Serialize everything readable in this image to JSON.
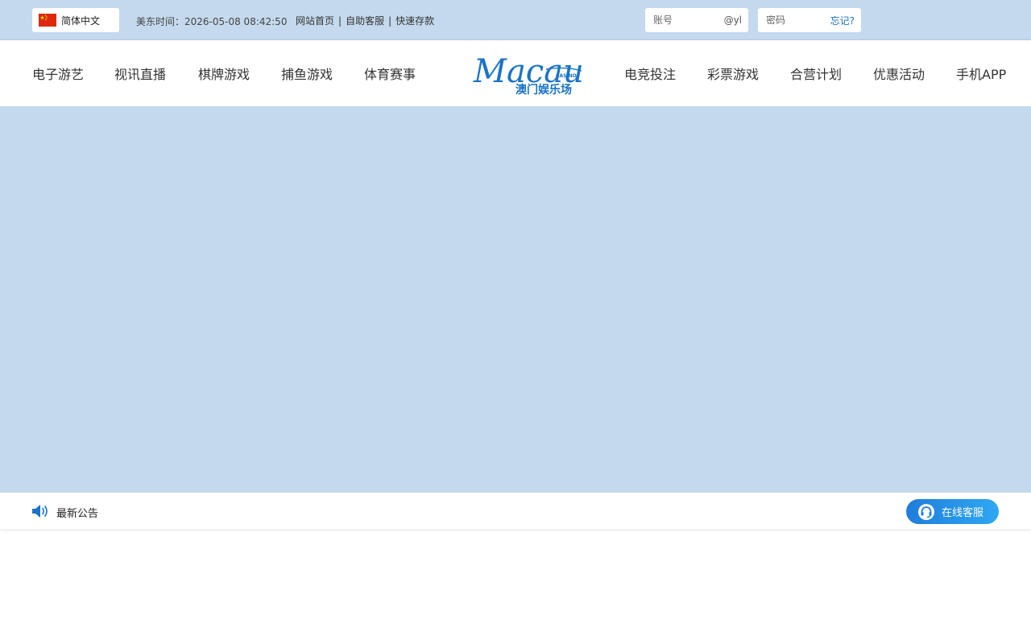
{
  "topbar": {
    "language": {
      "icon": "china-flag-icon",
      "label": "简体中文"
    },
    "clock_text": "美东时间：2026-05-08 08:42:50",
    "links": [
      "网站首页",
      "自助客服",
      "快速存款"
    ],
    "link_separator": "|",
    "account_field": {
      "placeholder": "账号",
      "suffix": "@yl"
    },
    "password_field": {
      "placeholder": "密码",
      "forgot_label": "忘记?"
    }
  },
  "nav": {
    "left_items": [
      "电子游艺",
      "视讯直播",
      "棋牌游戏",
      "捕鱼游戏",
      "体育赛事"
    ],
    "right_items": [
      "电竞投注",
      "彩票游戏",
      "合营计划",
      "优惠活动",
      "手机APP"
    ],
    "logo": {
      "script_text": "Macau",
      "tag_text": "CASINO",
      "name_text": "澳门娱乐场"
    }
  },
  "notice": {
    "icon": "speaker-icon",
    "label": "最新公告"
  },
  "customer_service": {
    "icon": "headset-icon",
    "label": "在线客服"
  },
  "colors": {
    "topbar_bg": "#c4d9ed",
    "banner_bg": "#c4d9ed",
    "brand_blue": "#1a73c8",
    "cs_gradient_start": "#1f7ddb",
    "cs_gradient_end": "#2fa8f2"
  }
}
